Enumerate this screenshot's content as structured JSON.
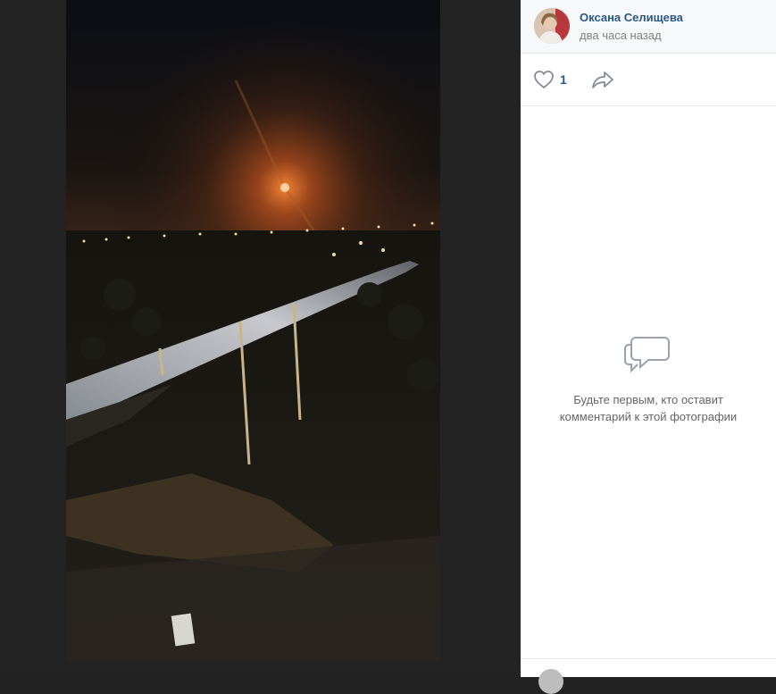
{
  "post": {
    "author_name": "Оксана Селищева",
    "time": "два часа назад"
  },
  "actions": {
    "like_icon": "heart-icon",
    "like_count": "1",
    "share_icon": "share-arrow-icon"
  },
  "comments": {
    "empty_icon": "comments-icon",
    "empty_line1": "Будьте первым, кто оставит",
    "empty_line2": "комментарий к этой фотографии"
  },
  "colors": {
    "author": "#2a5885",
    "muted": "#828282",
    "viewer_bg": "#232323",
    "moon": "#ff7a2a"
  }
}
